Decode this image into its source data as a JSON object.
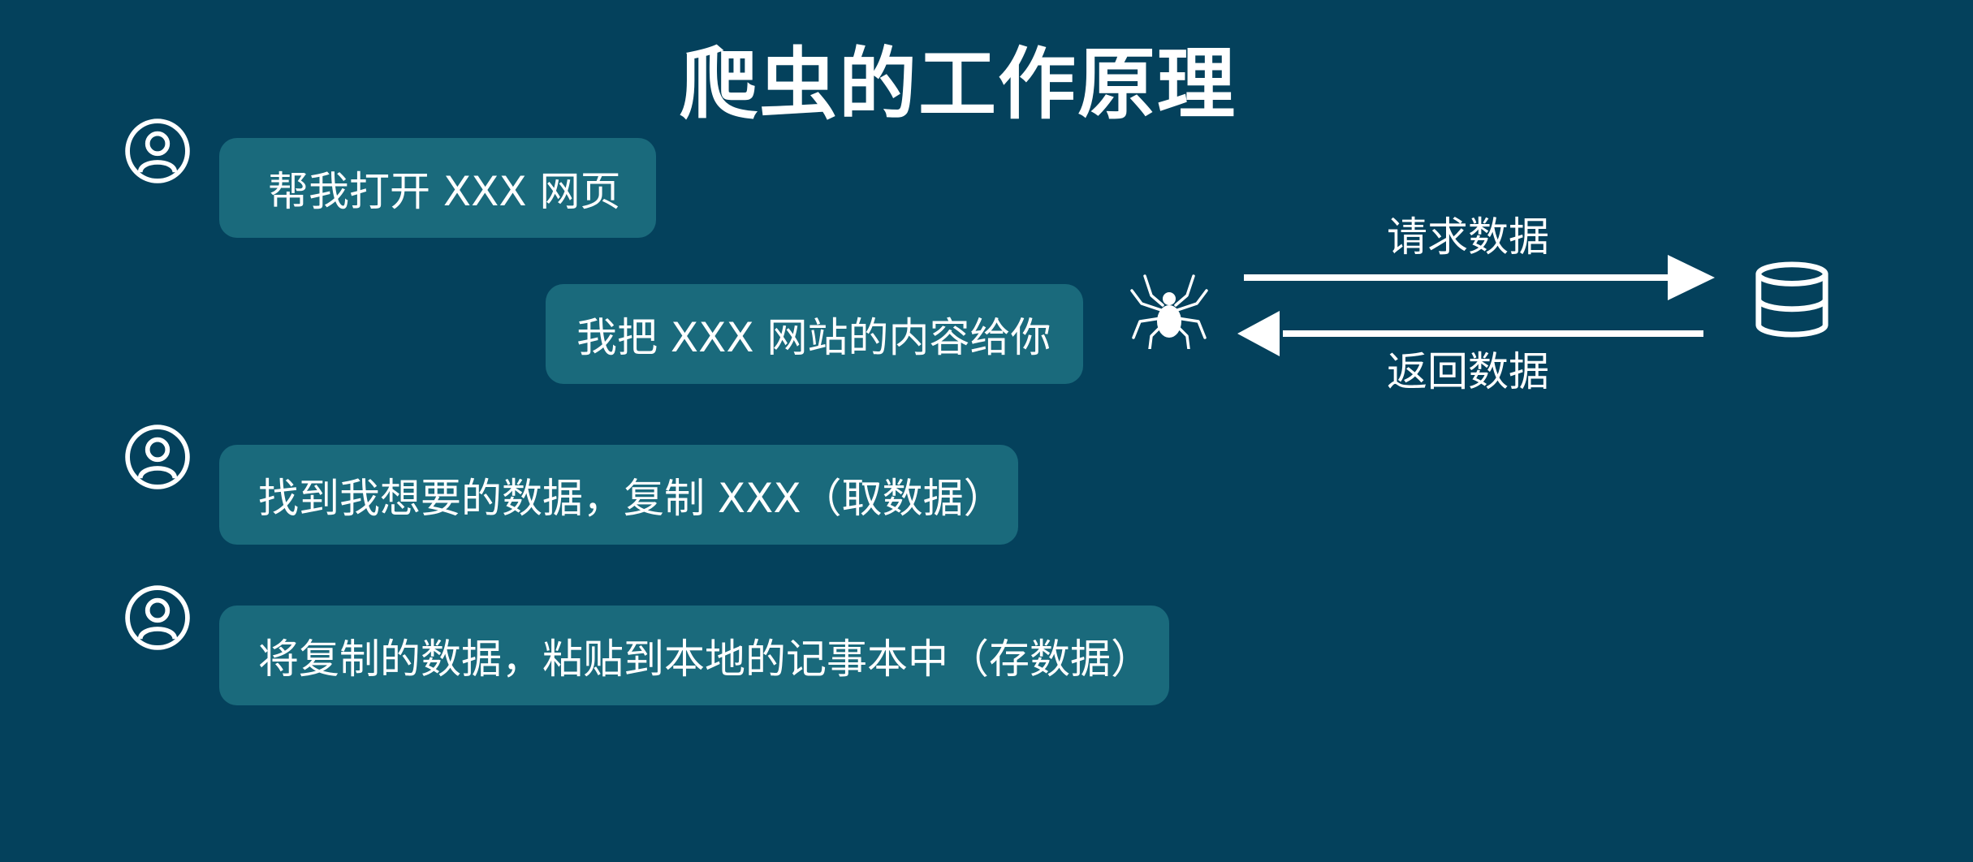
{
  "title": "爬虫的工作原理",
  "messages": [
    {
      "text": "帮我打开 XXX 网页"
    },
    {
      "text": "我把 XXX 网站的内容给你"
    },
    {
      "text": "找到我想要的数据，复制 XXX（取数据）"
    },
    {
      "text": "将复制的数据，粘贴到本地的记事本中（存数据）"
    }
  ],
  "flow": {
    "request_label": "请求数据",
    "response_label": "返回数据"
  },
  "icons": {
    "user": "user-icon",
    "spider": "spider-icon",
    "database": "database-icon"
  },
  "colors": {
    "background": "#04415c",
    "bubble": "#1a6a7c",
    "foreground": "#ffffff"
  }
}
